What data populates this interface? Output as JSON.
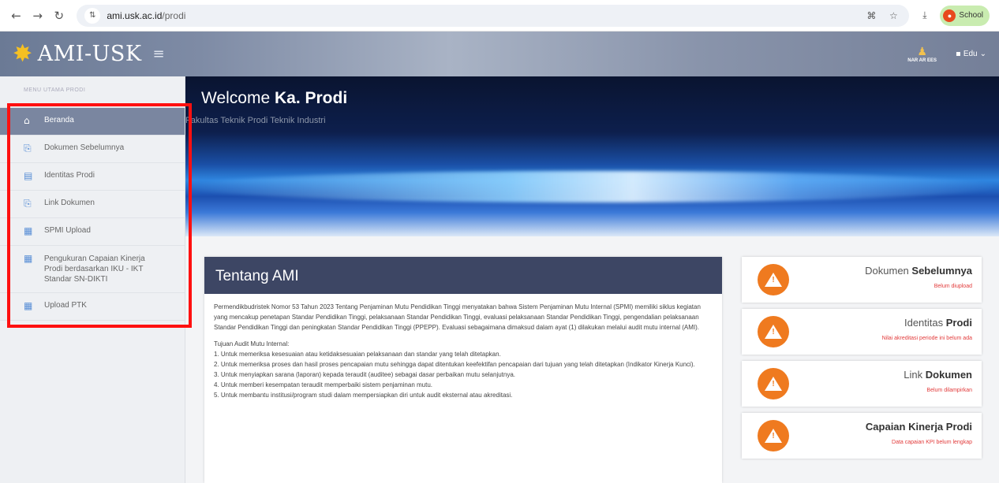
{
  "browser": {
    "url_domain": "ami.usk.ac.id",
    "url_path": "/prodi",
    "profile_label": "School"
  },
  "header": {
    "app_name": "AMI-USK",
    "notif_label": "NAR AR EES",
    "user_label": "Edu"
  },
  "sidebar": {
    "title": "MENU UTAMA PRODI",
    "items": [
      {
        "label": "Beranda",
        "icon": "home-icon"
      },
      {
        "label": "Dokumen Sebelumnya",
        "icon": "document-upload-icon"
      },
      {
        "label": "Identitas Prodi",
        "icon": "id-card-icon"
      },
      {
        "label": "Link Dokumen",
        "icon": "link-document-icon"
      },
      {
        "label": "SPMI Upload",
        "icon": "calendar-icon"
      },
      {
        "label": "Pengukuran Capaian Kinerja Prodi berdasarkan IKU - IKT Standar SN-DIKTI",
        "icon": "calendar-icon"
      },
      {
        "label": "Upload PTK",
        "icon": "calendar-icon"
      }
    ]
  },
  "hero": {
    "welcome": "Welcome",
    "role": "Ka. Prodi",
    "subtitle": "Fakultas Teknik Prodi Teknik Industri"
  },
  "about": {
    "title": "Tentang AMI",
    "paragraph": "Permendikbudristek Nomor 53 Tahun 2023 Tentang Penjaminan Mutu Pendidikan Tinggi menyatakan bahwa Sistem Penjaminan Mutu Internal (SPMI) memiliki siklus kegiatan yang mencakup penetapan Standar Pendidikan Tinggi, pelaksanaan Standar Pendidikan Tinggi, evaluasi pelaksanaan Standar Pendidikan Tinggi, pengendalian pelaksanaan Standar Pendidikan Tinggi dan peningkatan Standar Pendidikan Tinggi (PPEPP). Evaluasi sebagaimana dimaksud dalam ayat (1) dilakukan melalui audit mutu internal (AMI).",
    "goals_title": "Tujuan Audit Mutu Internal:",
    "goals": [
      "1. Untuk memeriksa kesesuaian atau ketidaksesuaian pelaksanaan dan standar yang telah ditetapkan.",
      "2. Untuk memeriksa proses dan hasil proses pencapaian mutu sehingga dapat ditentukan keefektifan pencapaian dari tujuan yang telah ditetapkan (Indikator Kinerja Kunci).",
      "3. Untuk menyiapkan sarana (laporan) kepada teraudit (auditee) sebagai dasar perbaikan mutu selanjutnya.",
      "4. Untuk memberi kesempatan teraudit memperbaiki sistem penjaminan mutu.",
      "5. Untuk membantu institusi/program studi dalam mempersiapkan diri untuk audit eksternal atau akreditasi."
    ]
  },
  "status_cards": [
    {
      "title_a": "Dokumen",
      "title_b": "Sebelumnya",
      "note": "Belum diupload"
    },
    {
      "title_a": "Identitas",
      "title_b": "Prodi",
      "note": "Nilai akreditasi periode ini belum ada"
    },
    {
      "title_a": "Link",
      "title_b": "Dokumen",
      "note": "Belum dilampirkan"
    },
    {
      "title_a": "",
      "title_b": "Capaian Kinerja Prodi",
      "note": "Data capaian KPI belum lengkap"
    }
  ],
  "colors": {
    "header_bg": "#7e8ba5",
    "sidebar_active": "#7a86a0",
    "about_head": "#3d4664",
    "warning": "#ef7a1f",
    "note_red": "#e23b3b",
    "highlight_box": "#ff1010"
  }
}
